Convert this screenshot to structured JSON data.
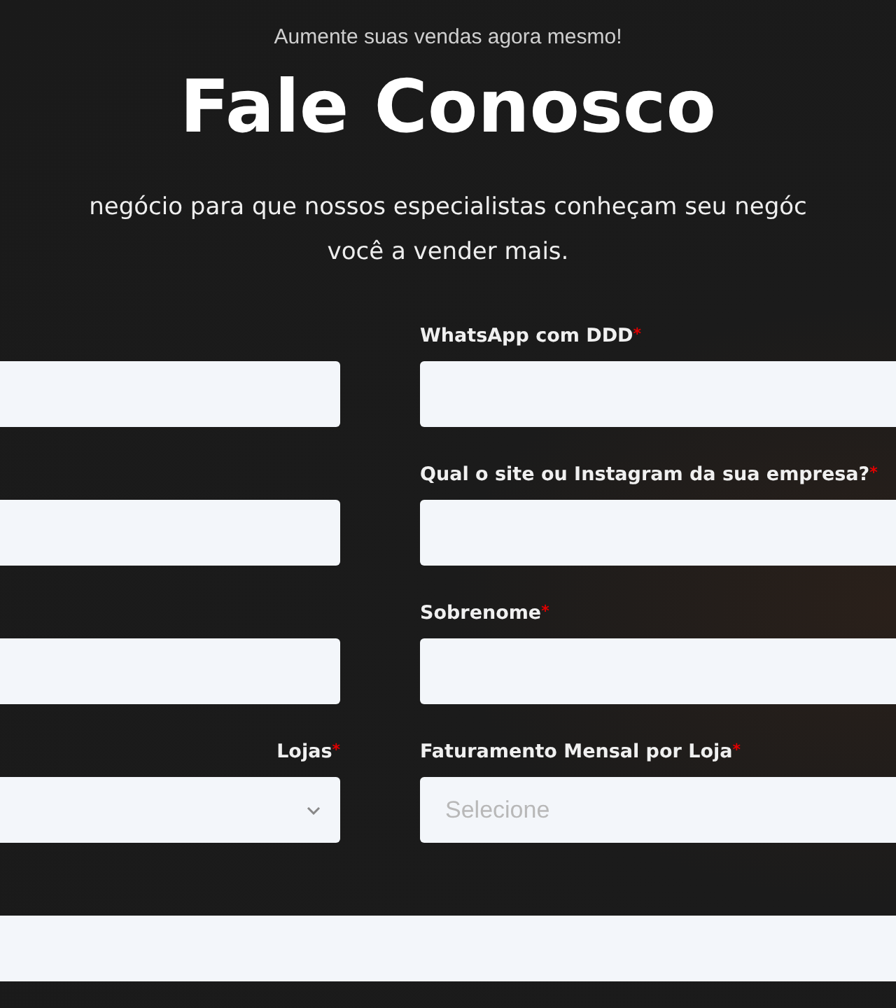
{
  "eyebrow": "Aumente suas vendas agora mesmo!",
  "title": "Fale Conosco",
  "description": "negócio para que nossos especialistas conheçam seu negóc\nvocê a vender mais.",
  "rows": [
    {
      "fields": [
        {
          "kind": "text"
        },
        {
          "kind": "text",
          "label": "WhatsApp com DDD",
          "required_mark": "*"
        }
      ]
    },
    {
      "fields": [
        {
          "kind": "text"
        },
        {
          "kind": "text",
          "label": "Qual o site ou Instagram da sua empresa?",
          "required_mark": "*"
        }
      ]
    },
    {
      "fields": [
        {
          "kind": "text"
        },
        {
          "kind": "text",
          "label": "Sobrenome",
          "required_mark": "*"
        }
      ]
    },
    {
      "fields": [
        {
          "kind": "select",
          "label": "Lojas",
          "required_mark": "*"
        },
        {
          "kind": "select",
          "label": "Faturamento Mensal por Loja",
          "required_mark": "*",
          "placeholder": "Selecione"
        }
      ]
    },
    {
      "fields": [
        {
          "kind": "text"
        }
      ]
    }
  ]
}
